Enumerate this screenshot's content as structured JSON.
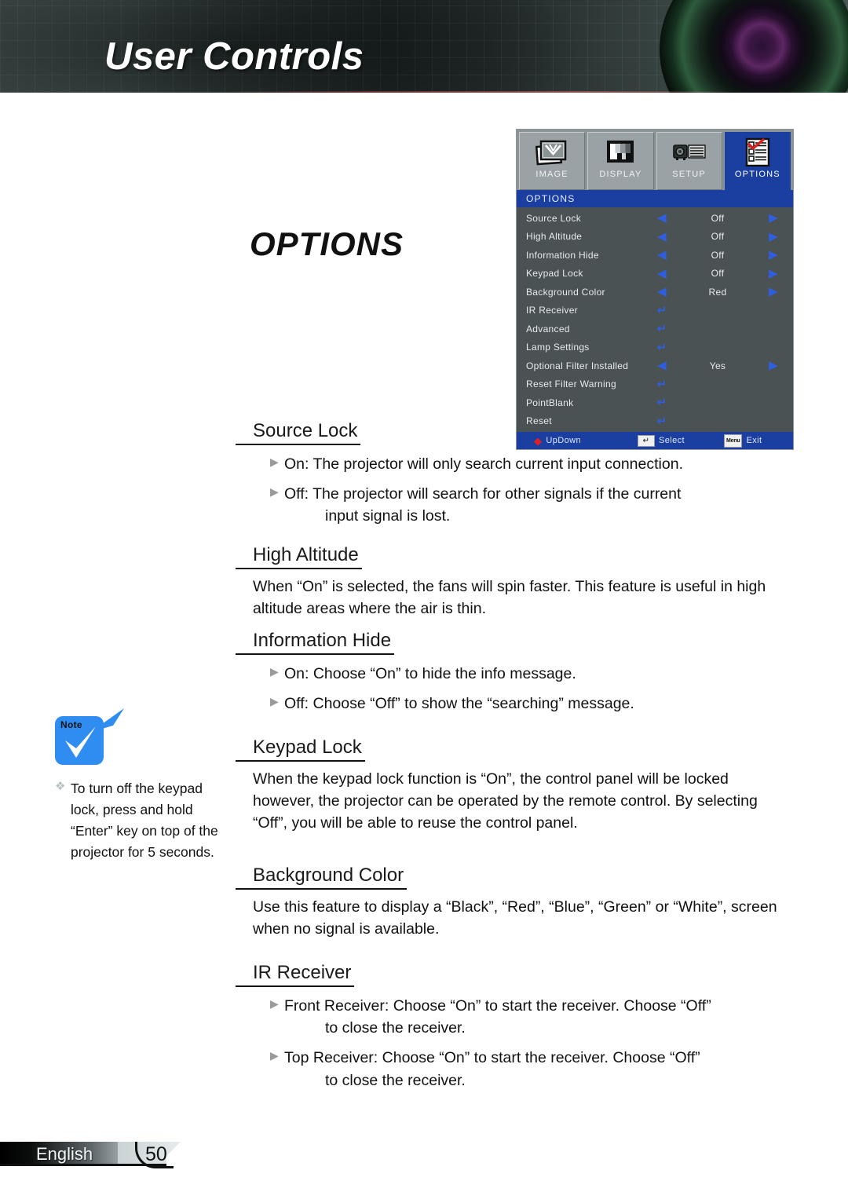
{
  "header": {
    "title": "User Controls",
    "lens_icon": "camera-lens-graphic"
  },
  "page_title": "OPTIONS",
  "osd": {
    "tabs": [
      {
        "label": "IMAGE",
        "icon": "image-tab-icon",
        "active": false
      },
      {
        "label": "DISPLAY",
        "icon": "display-tab-icon",
        "active": false
      },
      {
        "label": "SETUP",
        "icon": "setup-tab-icon",
        "active": false
      },
      {
        "label": "OPTIONS",
        "icon": "options-tab-icon",
        "active": true
      }
    ],
    "title": "OPTIONS",
    "accent_blue": "#1b3fa0",
    "panel_gray": "#4a5254",
    "arrow_blue": "#2f5fe0",
    "rows": [
      {
        "label": "Source Lock",
        "type": "value",
        "value": "Off"
      },
      {
        "label": "High Altitude",
        "type": "value",
        "value": "Off"
      },
      {
        "label": "Information Hide",
        "type": "value",
        "value": "Off"
      },
      {
        "label": "Keypad Lock",
        "type": "value",
        "value": "Off"
      },
      {
        "label": "Background Color",
        "type": "value",
        "value": "Red"
      },
      {
        "label": "IR Receiver",
        "type": "enter",
        "value": ""
      },
      {
        "label": "Advanced",
        "type": "enter",
        "value": ""
      },
      {
        "label": "Lamp Settings",
        "type": "enter",
        "value": ""
      },
      {
        "label": "Optional Filter Installed",
        "type": "value",
        "value": "Yes"
      },
      {
        "label": "Reset Filter Warning",
        "type": "enter",
        "value": ""
      },
      {
        "label": "PointBlank",
        "type": "enter",
        "value": ""
      },
      {
        "label": "Reset",
        "type": "enter",
        "value": ""
      }
    ],
    "footer": {
      "updown": "UpDown",
      "select": "Select",
      "exit": "Exit",
      "select_key": "↵",
      "exit_key": "Menu"
    }
  },
  "sections": [
    {
      "heading": "Source Lock",
      "bullets": [
        {
          "text": "On: The projector will only search current input connection.",
          "indent": ""
        },
        {
          "text": "Off: The projector will search for other signals if the current",
          "indent": "input signal is lost."
        }
      ],
      "paragraph": ""
    },
    {
      "heading": "High Altitude",
      "bullets": [],
      "paragraph": "When “On” is selected, the fans will spin faster. This feature is useful in high altitude areas where the air is thin."
    },
    {
      "heading": "Information Hide",
      "bullets": [
        {
          "text": "On: Choose “On” to hide the info message.",
          "indent": ""
        },
        {
          "text": "Off: Choose “Off” to show the “searching” message.",
          "indent": ""
        }
      ],
      "paragraph": ""
    },
    {
      "heading": "Keypad Lock",
      "bullets": [],
      "paragraph": "When the keypad lock function is “On”, the control panel will be locked however, the projector can be operated by the remote control. By selecting “Off”, you will be able to reuse the control panel."
    },
    {
      "heading": "Background Color",
      "bullets": [],
      "paragraph": "Use this feature to display a “Black”, “Red”, “Blue”, “Green” or “White”, screen when no signal is available."
    },
    {
      "heading": "IR Receiver",
      "bullets": [
        {
          "text": "Front Receiver: Choose “On” to start the receiver. Choose “Off”",
          "indent": "to close the receiver."
        },
        {
          "text": "Top Receiver: Choose “On” to start the receiver. Choose “Off”",
          "indent": "to close the receiver."
        }
      ],
      "paragraph": ""
    }
  ],
  "note": {
    "icon_label": "Note",
    "icon_name": "note-checkmark-icon",
    "bullet_glyph": "❖",
    "text": "To turn off the keypad lock, press and hold “Enter” key on top of the projector for 5 seconds."
  },
  "footer": {
    "language": "English",
    "page_number": "50"
  }
}
